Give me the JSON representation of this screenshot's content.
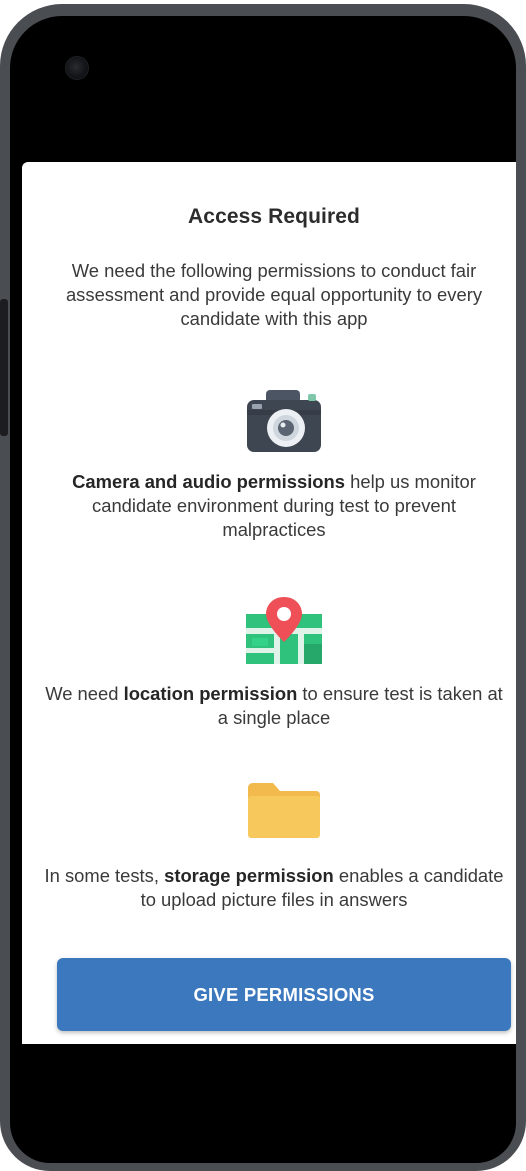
{
  "screen": {
    "title": "Access Required",
    "intro": "We need the following permissions to conduct fair assessment and provide equal opportunity to every candidate with this app"
  },
  "permissions": [
    {
      "icon": "camera-icon",
      "bold": "Camera and audio permissions",
      "before": "",
      "after": " help us monitor candidate environment during test to prevent malpractices"
    },
    {
      "icon": "map-location-icon",
      "before": "We need ",
      "bold": "location permission",
      "after": " to ensure test is taken at a single place"
    },
    {
      "icon": "folder-icon",
      "before": "In some tests, ",
      "bold": "storage permission",
      "after": " enables a candidate to upload picture files in answers"
    }
  ],
  "button": {
    "label": "GIVE PERMISSIONS"
  },
  "colors": {
    "button": "#3b78be",
    "folder": "#f7c95c",
    "map_pin": "#ef4f57",
    "map_base": "#2fc27d",
    "camera_body": "#3e4652"
  }
}
